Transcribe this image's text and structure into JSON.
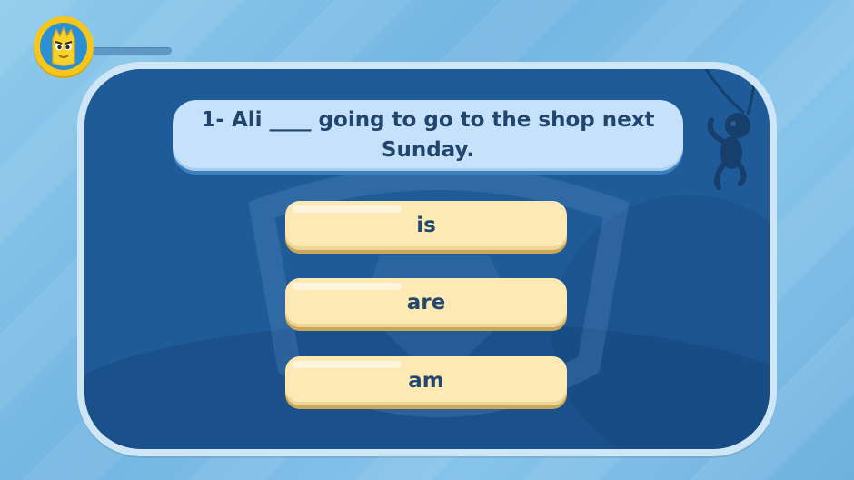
{
  "quiz": {
    "question": "1- Ali ____ going to go to the shop next Sunday.",
    "answers": [
      {
        "label": "is"
      },
      {
        "label": "are"
      },
      {
        "label": "am"
      }
    ],
    "progress": 0.0
  },
  "icons": {
    "avatar": "yellow-monster-avatar-icon",
    "decor": "hanging-monkey-icon",
    "watermark": "shield-watermark-icon"
  },
  "colors": {
    "background": "#7ebee6",
    "board": "#1f5b98",
    "question_bg": "#c6e2fb",
    "answer_bg": "#fde9b4",
    "text": "#25486f",
    "avatar_ring": "#f7c61a"
  }
}
